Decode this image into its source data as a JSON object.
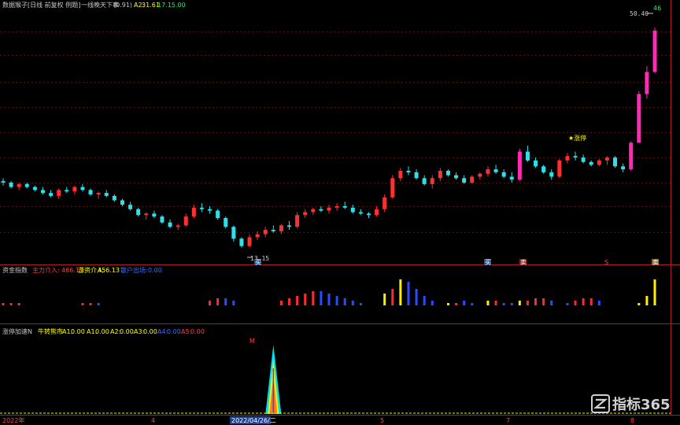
{
  "header": {
    "title": "数据猴子[日线 前复权 例题]",
    "indicator": "一线晚天下率",
    "param": "(0.91)",
    "a2_label": "A2:",
    "a2_value": "31.61",
    "extra_value": "17.15.00"
  },
  "price_panel": {
    "price_high_label": "50.40",
    "price_low_label": "13.15",
    "peak_marker": "46",
    "buy_marker": "★涨停",
    "low_marker": "买",
    "bottom_tags": [
      "买",
      "卖",
      "S",
      "卖"
    ]
  },
  "panel2": {
    "title": "资金指数",
    "items": [
      {
        "label": "主力介入:",
        "value": "466.13",
        "color": "#ff3b3b"
      },
      {
        "label": "游资介入:",
        "value": "456.13",
        "color": "#ffff00"
      },
      {
        "label": "散户出场:",
        "value": "0.00",
        "color": "#3b6bff"
      }
    ]
  },
  "panel3": {
    "title": "涨停加速N",
    "subtitle": "牛转熊市",
    "items": [
      {
        "label": "A1:",
        "value": "0.00"
      },
      {
        "label": "A1:",
        "value": "0.00"
      },
      {
        "label": "A2:",
        "value": "0.00"
      },
      {
        "label": "A3:",
        "value": "0.00"
      },
      {
        "label": "A4:",
        "value": "0.00"
      },
      {
        "label": "A5:",
        "value": "0.00"
      }
    ],
    "spike_marker": "M"
  },
  "x_axis": {
    "labels": [
      "2022年",
      "4",
      "5",
      "7",
      "8"
    ],
    "cursor_label": "2022/04/26/二"
  },
  "watermark": {
    "text": "指标365"
  },
  "chart_data": [
    {
      "type": "candlestick",
      "candles": [
        [
          16.4,
          16.6,
          16.1,
          16.3
        ],
        [
          16.3,
          16.4,
          15.9,
          16.0
        ],
        [
          16.0,
          16.3,
          15.8,
          16.2
        ],
        [
          16.2,
          16.3,
          15.9,
          16.0
        ],
        [
          16.0,
          16.1,
          15.7,
          15.8
        ],
        [
          15.8,
          16.0,
          15.5,
          15.6
        ],
        [
          15.6,
          15.8,
          15.3,
          15.4
        ],
        [
          15.4,
          15.9,
          15.2,
          15.8
        ],
        [
          15.8,
          16.0,
          15.6,
          15.7
        ],
        [
          15.7,
          16.1,
          15.5,
          16.0
        ],
        [
          16.0,
          16.2,
          15.7,
          15.8
        ],
        [
          15.8,
          15.9,
          15.4,
          15.5
        ],
        [
          15.5,
          15.7,
          15.2,
          15.6
        ],
        [
          15.6,
          15.8,
          15.3,
          15.4
        ],
        [
          15.4,
          15.5,
          15.0,
          15.1
        ],
        [
          15.1,
          15.2,
          14.7,
          14.8
        ],
        [
          14.8,
          15.0,
          14.4,
          14.5
        ],
        [
          14.5,
          14.6,
          14.0,
          14.1
        ],
        [
          14.1,
          14.3,
          13.8,
          14.2
        ],
        [
          14.2,
          14.4,
          13.9,
          14.0
        ],
        [
          14.0,
          14.1,
          13.5,
          13.6
        ],
        [
          13.6,
          13.8,
          13.2,
          13.3
        ],
        [
          13.3,
          13.5,
          13.1,
          13.4
        ],
        [
          13.4,
          14.2,
          13.3,
          14.0
        ],
        [
          14.0,
          14.8,
          13.9,
          14.6
        ],
        [
          14.6,
          14.9,
          14.3,
          14.5
        ],
        [
          14.5,
          14.7,
          14.2,
          14.4
        ],
        [
          14.4,
          14.5,
          13.8,
          13.9
        ],
        [
          13.9,
          14.0,
          13.2,
          13.3
        ],
        [
          13.3,
          13.4,
          12.3,
          12.5
        ],
        [
          12.5,
          12.6,
          11.9,
          12.0
        ],
        [
          12.0,
          12.8,
          11.9,
          12.6
        ],
        [
          12.6,
          13.0,
          12.4,
          12.8
        ],
        [
          12.8,
          13.3,
          12.6,
          13.1
        ],
        [
          13.1,
          13.4,
          12.9,
          13.0
        ],
        [
          13.0,
          13.5,
          12.8,
          13.4
        ],
        [
          13.4,
          13.7,
          13.1,
          13.3
        ],
        [
          13.3,
          14.3,
          13.2,
          14.1
        ],
        [
          14.1,
          14.5,
          13.9,
          14.3
        ],
        [
          14.3,
          14.6,
          14.1,
          14.5
        ],
        [
          14.5,
          14.7,
          14.3,
          14.4
        ],
        [
          14.4,
          14.8,
          14.2,
          14.6
        ],
        [
          14.6,
          14.9,
          14.4,
          14.7
        ],
        [
          14.7,
          15.0,
          14.5,
          14.6
        ],
        [
          14.6,
          14.8,
          14.2,
          14.3
        ],
        [
          14.3,
          14.5,
          14.1,
          14.2
        ],
        [
          14.2,
          14.3,
          13.9,
          14.1
        ],
        [
          14.1,
          14.7,
          14.0,
          14.5
        ],
        [
          14.5,
          15.5,
          14.3,
          15.3
        ],
        [
          15.3,
          16.8,
          15.2,
          16.6
        ],
        [
          16.6,
          17.3,
          16.4,
          17.1
        ],
        [
          17.1,
          17.4,
          16.8,
          17.0
        ],
        [
          17.0,
          17.2,
          16.5,
          16.6
        ],
        [
          16.6,
          16.8,
          16.1,
          16.2
        ],
        [
          16.2,
          16.8,
          15.9,
          16.6
        ],
        [
          16.6,
          17.3,
          16.4,
          17.1
        ],
        [
          17.1,
          17.2,
          16.7,
          16.8
        ],
        [
          16.8,
          17.0,
          16.5,
          16.6
        ],
        [
          16.6,
          16.8,
          16.2,
          16.3
        ],
        [
          16.3,
          16.8,
          16.2,
          16.7
        ],
        [
          16.7,
          17.0,
          16.5,
          16.9
        ],
        [
          16.9,
          17.4,
          16.7,
          17.2
        ],
        [
          17.2,
          17.5,
          16.9,
          17.0
        ],
        [
          17.0,
          17.2,
          16.6,
          16.7
        ],
        [
          16.7,
          17.0,
          16.3,
          16.5
        ],
        [
          16.5,
          18.6,
          16.4,
          18.4
        ],
        [
          18.4,
          18.8,
          17.7,
          17.8
        ],
        [
          17.8,
          18.0,
          17.3,
          17.4
        ],
        [
          17.4,
          17.5,
          16.9,
          17.0
        ],
        [
          17.0,
          17.2,
          16.5,
          16.7
        ],
        [
          16.7,
          17.9,
          16.6,
          17.8
        ],
        [
          17.8,
          18.3,
          17.6,
          18.1
        ],
        [
          18.1,
          18.4,
          17.8,
          18.0
        ],
        [
          18.0,
          18.2,
          17.6,
          17.7
        ],
        [
          17.7,
          17.8,
          17.4,
          17.5
        ],
        [
          17.5,
          17.9,
          17.4,
          17.8
        ],
        [
          17.8,
          18.1,
          17.5,
          18.0
        ],
        [
          18.0,
          18.1,
          17.3,
          17.4
        ],
        [
          17.4,
          17.6,
          17.0,
          17.2
        ],
        [
          17.2,
          19.1,
          17.1,
          19.0
        ],
        [
          19.0,
          22.5,
          19.0,
          22.3
        ],
        [
          22.3,
          24.2,
          22.0,
          23.8
        ],
        [
          23.8,
          26.8,
          23.7,
          26.6
        ]
      ],
      "ylim": [
        11.5,
        27.5
      ],
      "price_high": "50.40",
      "price_low": "13.15"
    },
    {
      "type": "bar",
      "name": "资金指数",
      "values": [
        [
          1,
          "r"
        ],
        [
          1,
          "r"
        ],
        [
          1,
          "r"
        ],
        [
          0,
          ""
        ],
        [
          0,
          ""
        ],
        [
          0,
          ""
        ],
        [
          0,
          ""
        ],
        [
          0,
          ""
        ],
        [
          0,
          ""
        ],
        [
          0,
          ""
        ],
        [
          1,
          "r"
        ],
        [
          1,
          "r"
        ],
        [
          1,
          "b"
        ],
        [
          0,
          ""
        ],
        [
          0,
          ""
        ],
        [
          0,
          ""
        ],
        [
          0,
          ""
        ],
        [
          0,
          ""
        ],
        [
          0,
          ""
        ],
        [
          0,
          ""
        ],
        [
          0,
          ""
        ],
        [
          0,
          ""
        ],
        [
          0,
          ""
        ],
        [
          0,
          ""
        ],
        [
          0,
          ""
        ],
        [
          0,
          ""
        ],
        [
          2,
          "r"
        ],
        [
          3,
          "r"
        ],
        [
          3,
          "b"
        ],
        [
          2,
          "b"
        ],
        [
          0,
          ""
        ],
        [
          0,
          ""
        ],
        [
          0,
          ""
        ],
        [
          0,
          ""
        ],
        [
          0,
          ""
        ],
        [
          2,
          "r"
        ],
        [
          3,
          "r"
        ],
        [
          4,
          "r"
        ],
        [
          5,
          "r"
        ],
        [
          6,
          "r"
        ],
        [
          6,
          "b"
        ],
        [
          5,
          "b"
        ],
        [
          4,
          "b"
        ],
        [
          3,
          "b"
        ],
        [
          2,
          "b"
        ],
        [
          1,
          "b"
        ],
        [
          0,
          ""
        ],
        [
          0,
          ""
        ],
        [
          5,
          "y"
        ],
        [
          7,
          "r"
        ],
        [
          11,
          "y"
        ],
        [
          10,
          "b"
        ],
        [
          7,
          "b"
        ],
        [
          4,
          "b"
        ],
        [
          2,
          "b"
        ],
        [
          0,
          ""
        ],
        [
          1,
          "y"
        ],
        [
          1,
          "r"
        ],
        [
          2,
          "b"
        ],
        [
          1,
          "b"
        ],
        [
          0,
          ""
        ],
        [
          2,
          "y"
        ],
        [
          2,
          "r"
        ],
        [
          1,
          "b"
        ],
        [
          1,
          "b"
        ],
        [
          2,
          "y"
        ],
        [
          2,
          "r"
        ],
        [
          3,
          "r"
        ],
        [
          3,
          "r"
        ],
        [
          2,
          "b"
        ],
        [
          0,
          ""
        ],
        [
          1,
          "b"
        ],
        [
          2,
          "r"
        ],
        [
          3,
          "r"
        ],
        [
          3,
          "r"
        ],
        [
          2,
          "b"
        ],
        [
          0,
          ""
        ],
        [
          0,
          ""
        ],
        [
          0,
          ""
        ],
        [
          0,
          ""
        ],
        [
          1,
          "y"
        ],
        [
          4,
          "y"
        ],
        [
          11,
          "y"
        ]
      ],
      "ylim": [
        0,
        12
      ]
    },
    {
      "type": "area",
      "name": "涨停加速N",
      "x": [
        0,
        33.6,
        34.0,
        34.4,
        82
      ],
      "values": [
        0,
        0,
        10,
        0,
        0
      ],
      "ylim": [
        0,
        10
      ]
    }
  ]
}
